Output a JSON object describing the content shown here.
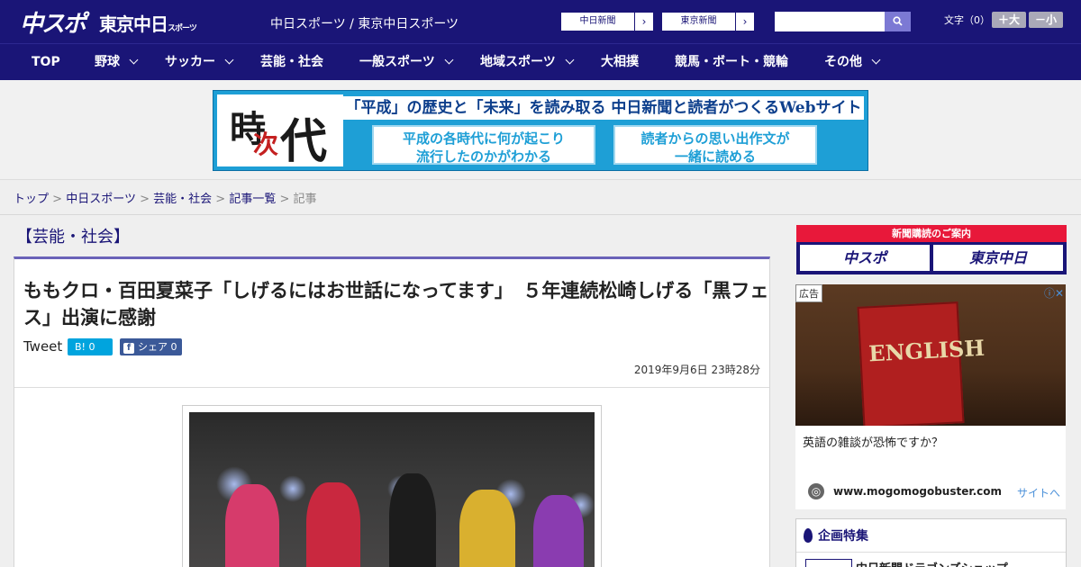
{
  "header": {
    "logo_main": "中スポ",
    "logo_tokyo": "東京中日",
    "logo_tokyo_small": "スポーツ",
    "site_links": "中日スポーツ / 東京中日スポーツ",
    "paper1": "中日新聞",
    "paper2": "東京新聞",
    "search_placeholder": "",
    "font_label": "文字（0）",
    "size_up": "＋大",
    "size_down": "－小"
  },
  "nav": [
    "TOP",
    "野球",
    "サッカー",
    "芸能・社会",
    "一般スポーツ",
    "地域スポーツ",
    "大相撲",
    "競馬・ボート・競輪",
    "その他"
  ],
  "banner": {
    "ji1": "時",
    "ji2": "次",
    "ji3": "代",
    "headline": "「平成」の歴史と「未来」を読み取る 中日新聞と読者がつくるWebサイト",
    "sub1a": "平成の各時代に何が起こり",
    "sub1b": "流行したのかがわかる",
    "sub2a": "読者からの思い出作文が",
    "sub2b": "一緒に読める"
  },
  "breadcrumb": {
    "top": "トップ",
    "chunichi": "中日スポーツ",
    "category": "芸能・社会",
    "list": "記事一覧",
    "current": "記事",
    "sep": ">"
  },
  "article": {
    "category": "【芸能・社会】",
    "title": "ももクロ・百田夏菜子「しげるにはお世話になってます」　５年連続松崎しげる「黒フェス」出演に感謝",
    "tweet": "Tweet",
    "hatena": "B! 0",
    "fb_icon": "f",
    "fb": "シェア 0",
    "date": "2019年9月6日 23時28分"
  },
  "sidebar": {
    "sub_head": "新聞購読のご案内",
    "sub_btn1": "中スポ",
    "sub_btn2": "東京中日",
    "ad_label": "広告",
    "ad_close": "ⓘ✕",
    "ad_book": "ENGLISH",
    "ad_text": "英語の雑談が恐怖ですか？",
    "ad_domain": "www.mogomogobuster.com",
    "ad_link": "サイトへ",
    "feature_head": "企画特集",
    "feature_item": "中日新聞ドラゴンズショップ"
  },
  "colors": {
    "brand": "#1a1577",
    "accent": "#6a63b8",
    "red": "#e8183a"
  }
}
